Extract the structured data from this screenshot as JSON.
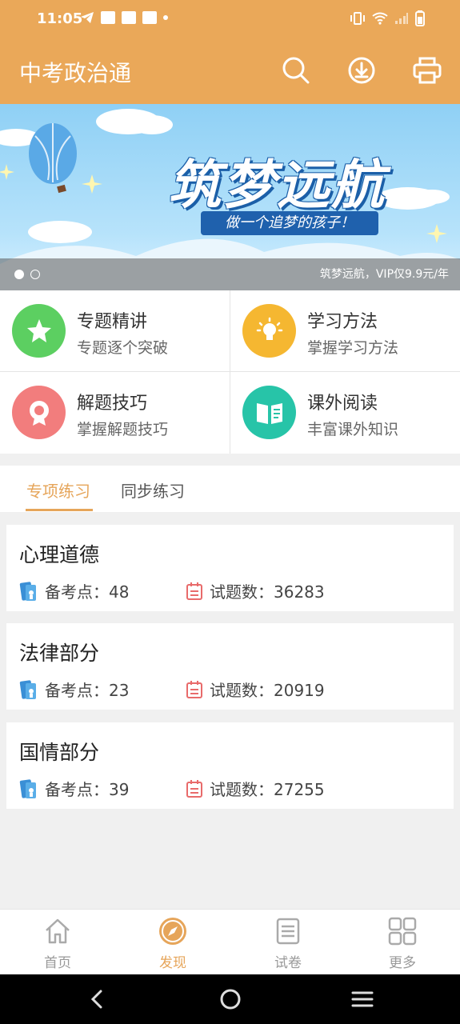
{
  "status": {
    "time": "11:05"
  },
  "appbar": {
    "title": "中考政治通"
  },
  "banner": {
    "headline": "筑梦远航",
    "slogan": "做一个追梦的孩子！",
    "caption": "筑梦远航，VIP仅9.9元/年"
  },
  "grid": [
    {
      "title": "专题精讲",
      "subtitle": "专题逐个突破",
      "color": "#5ccf61",
      "icon": "star-icon"
    },
    {
      "title": "学习方法",
      "subtitle": "掌握学习方法",
      "color": "#f5b731",
      "icon": "lightbulb-icon"
    },
    {
      "title": "解题技巧",
      "subtitle": "掌握解题技巧",
      "color": "#f27d7d",
      "icon": "medal-icon"
    },
    {
      "title": "课外阅读",
      "subtitle": "丰富课外知识",
      "color": "#27c4a8",
      "icon": "book-icon"
    }
  ],
  "tabs": [
    "专项练习",
    "同步练习"
  ],
  "cards": [
    {
      "title": "心理道德",
      "points_label": "备考点：48",
      "questions_label": "试题数：36283"
    },
    {
      "title": "法律部分",
      "points_label": "备考点：23",
      "questions_label": "试题数：20919"
    },
    {
      "title": "国情部分",
      "points_label": "备考点：39",
      "questions_label": "试题数：27255"
    }
  ],
  "nav": [
    {
      "label": "首页",
      "icon": "home-icon"
    },
    {
      "label": "发现",
      "icon": "compass-icon"
    },
    {
      "label": "试卷",
      "icon": "paper-icon"
    },
    {
      "label": "更多",
      "icon": "grid-icon"
    }
  ],
  "colors": {
    "primary": "#eaa859",
    "accent": "#e6a55a"
  }
}
